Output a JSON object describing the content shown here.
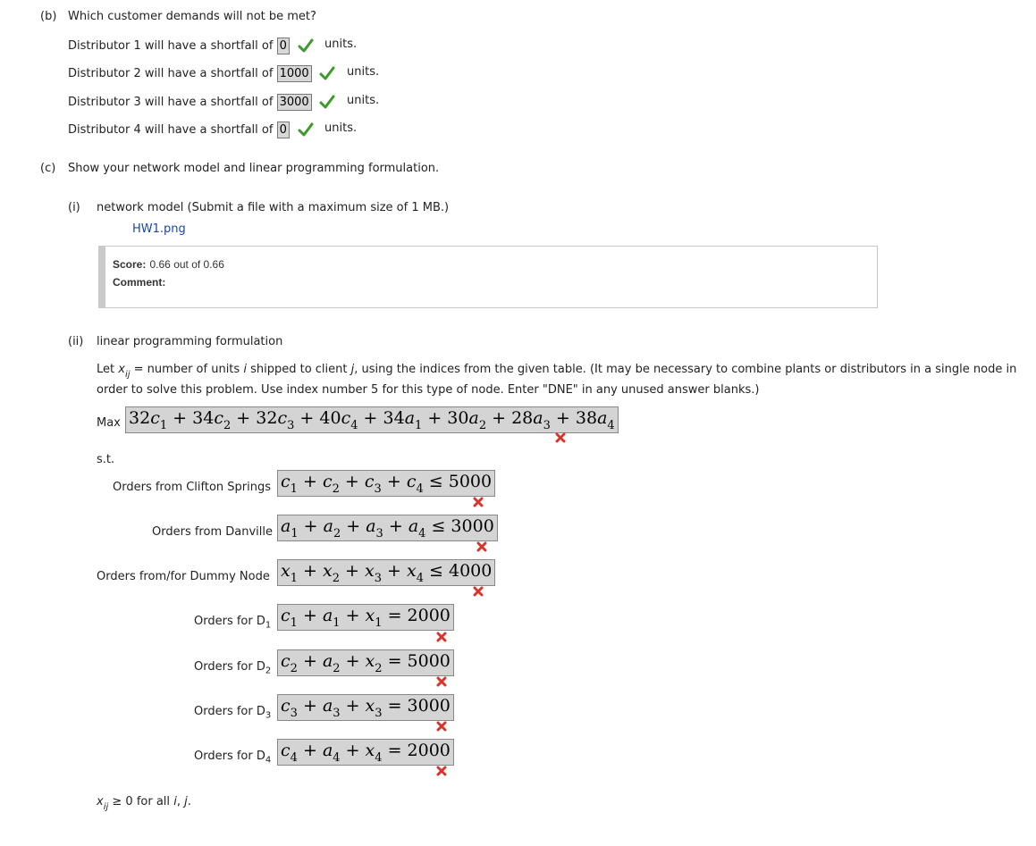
{
  "part_b": {
    "label": "(b)",
    "question": "Which customer demands will not be met?",
    "rows": [
      {
        "prefix": "Distributor 1 will have a shortfall of",
        "value": "0",
        "suffix": "units."
      },
      {
        "prefix": "Distributor 2 will have a shortfall of",
        "value": "1000",
        "suffix": "units."
      },
      {
        "prefix": "Distributor 3 will have a shortfall of",
        "value": "3000",
        "suffix": "units."
      },
      {
        "prefix": "Distributor 4 will have a shortfall of",
        "value": "0",
        "suffix": "units."
      }
    ]
  },
  "part_c": {
    "label": "(c)",
    "question": "Show your network model and linear programming formulation.",
    "sub_i": {
      "label": "(i)",
      "text": "network model (Submit a file with a maximum size of 1 MB.)",
      "file_link": "HW1.png",
      "score_label": "Score:",
      "score_value": "0.66 out of 0.66",
      "comment_label": "Comment:"
    },
    "sub_ii": {
      "label": "(ii)",
      "text": "linear programming formulation",
      "intro_line1_a": "Let",
      "intro_line1_b": "= number of units",
      "intro_line1_c": "shipped to client",
      "intro_line1_d": ", using the indices from the given table. (It may be necessary to combine plants or distributors in a single node in",
      "intro_line2": "order to solve this problem. Use index number 5 for this type of node. Enter \"DNE\" in any unused answer blanks.)",
      "max_label": "Max",
      "st_label": "s.t.",
      "constraints": [
        {
          "label": "Orders from Clifton Springs"
        },
        {
          "label": "Orders from Danville"
        },
        {
          "label": "Orders from/for Dummy Node"
        },
        {
          "label": "Orders for D",
          "sub": "1"
        },
        {
          "label": "Orders for D",
          "sub": "2"
        },
        {
          "label": "Orders for D",
          "sub": "3"
        },
        {
          "label": "Orders for D",
          "sub": "4"
        }
      ],
      "nonneg_text": "≥ 0 for all"
    }
  },
  "icons": {
    "correct": "check-icon",
    "incorrect": "cross-icon"
  },
  "colors": {
    "check": "#3a9a2a",
    "cross": "#d9342b",
    "link": "#1a45a8",
    "answer_bg": "#d8d8d8"
  }
}
